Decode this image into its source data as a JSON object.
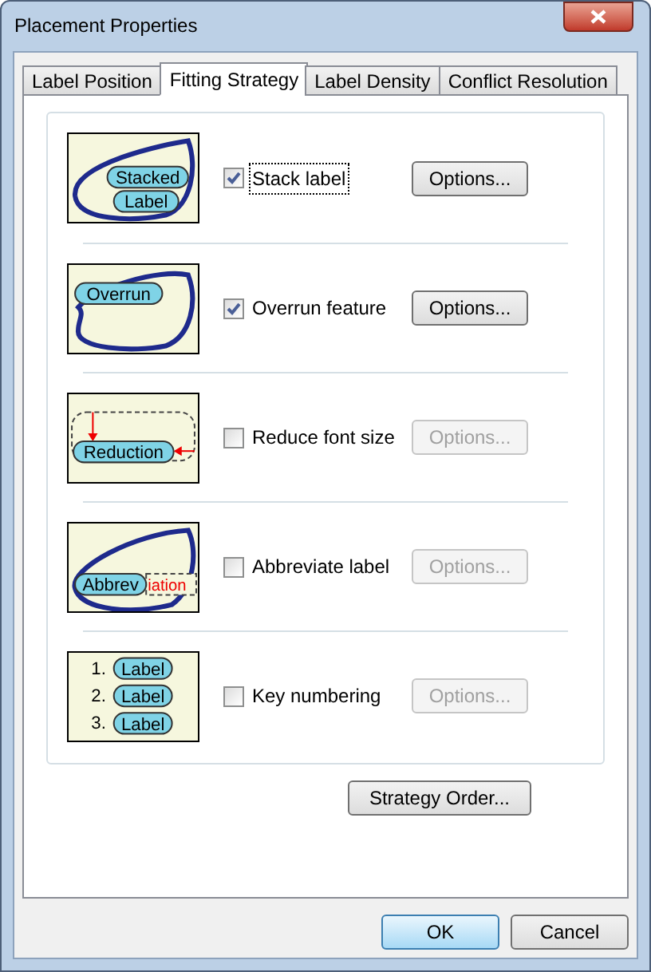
{
  "window": {
    "title": "Placement Properties"
  },
  "tabs": [
    {
      "label": "Label Position",
      "selected": false
    },
    {
      "label": "Fitting Strategy",
      "selected": true
    },
    {
      "label": "Label Density",
      "selected": false
    },
    {
      "label": "Conflict Resolution",
      "selected": false
    }
  ],
  "strategies": [
    {
      "illustration": {
        "kind": "stacked",
        "texts": [
          "Stacked",
          "Label"
        ]
      },
      "label": "Stack label",
      "checked": true,
      "focused": true,
      "options": {
        "label": "Options...",
        "disabled": false
      }
    },
    {
      "illustration": {
        "kind": "overrun",
        "texts": [
          "Overrun"
        ]
      },
      "label": "Overrun feature",
      "checked": true,
      "focused": false,
      "options": {
        "label": "Options...",
        "disabled": false
      }
    },
    {
      "illustration": {
        "kind": "reduction",
        "texts": [
          "Reduction"
        ]
      },
      "label": "Reduce font size",
      "checked": false,
      "focused": false,
      "options": {
        "label": "Options...",
        "disabled": true
      }
    },
    {
      "illustration": {
        "kind": "abbreviate",
        "texts": [
          "Abbrev",
          "iation"
        ]
      },
      "label": "Abbreviate label",
      "checked": false,
      "focused": false,
      "options": {
        "label": "Options...",
        "disabled": true
      }
    },
    {
      "illustration": {
        "kind": "numbering",
        "texts": [
          "1.",
          "Label",
          "2.",
          "Label",
          "3.",
          "Label"
        ]
      },
      "label": "Key numbering",
      "checked": false,
      "focused": false,
      "options": {
        "label": "Options...",
        "disabled": true
      }
    }
  ],
  "strategy_order_button": "Strategy Order...",
  "buttons": [
    {
      "label": "OK",
      "default": true
    },
    {
      "label": "Cancel",
      "default": false
    }
  ]
}
